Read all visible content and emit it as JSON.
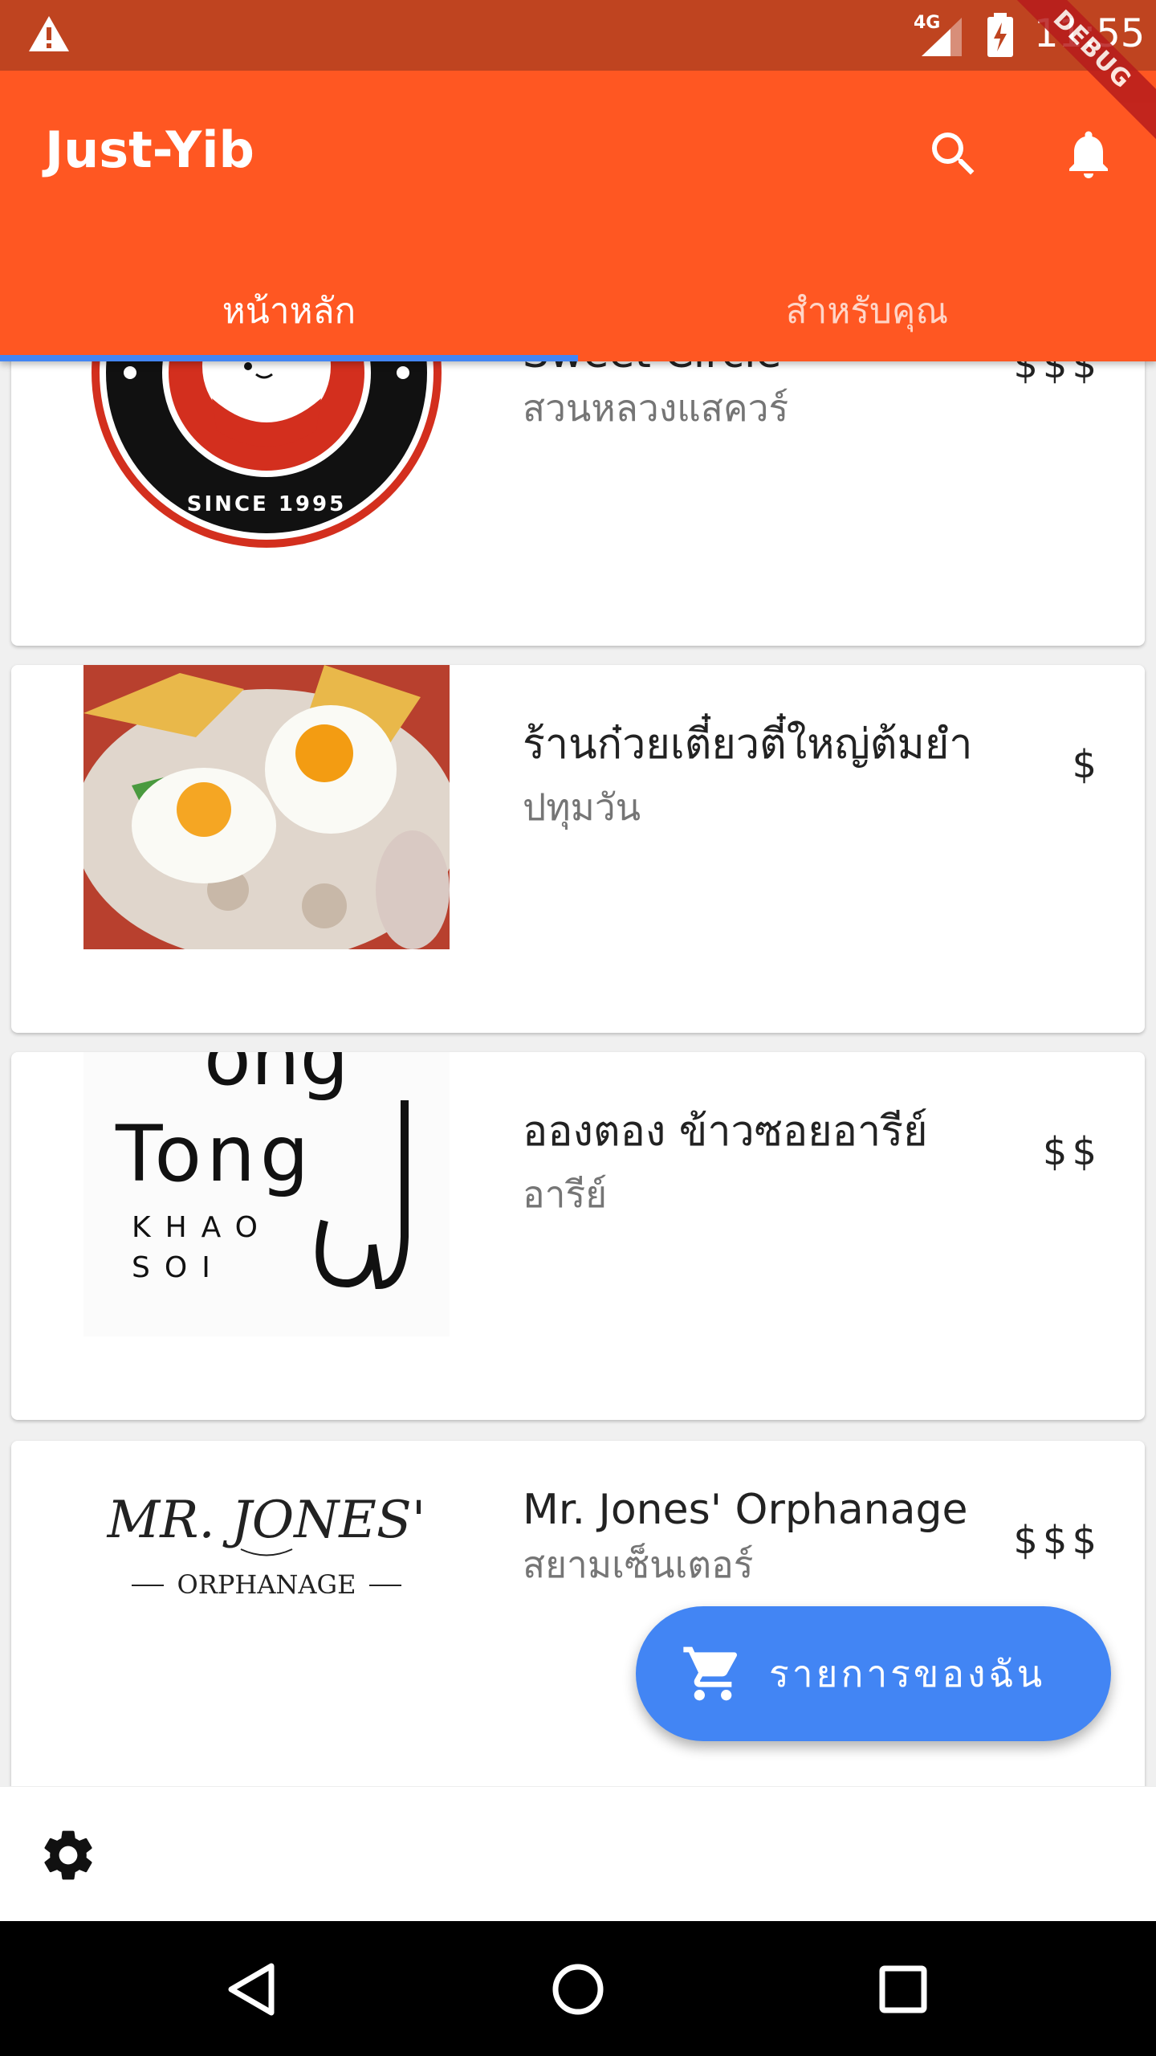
{
  "status_bar": {
    "network": "4G",
    "time": "11:55"
  },
  "debug_banner": "DEBUG",
  "app_bar": {
    "title": "Just-Yib"
  },
  "tabs": [
    {
      "label": "หน้าหลัก",
      "active": true
    },
    {
      "label": "สำหรับคุณ",
      "active": false
    }
  ],
  "restaurants": [
    {
      "name": "Sweet Circle",
      "area": "สวนหลวงแสควร์",
      "price": "$$$",
      "logo_text": "SINCE 1995"
    },
    {
      "name": "ร้านก๋วยเตี๋ยวตี๋ใหญ่ต้มยำ",
      "area": "ปทุมวัน",
      "price": "$"
    },
    {
      "name": "อองตอง ข้าวซอยอารีย์",
      "area": "อารีย์",
      "price": "$$",
      "logo_text_1": "ong",
      "logo_text_2": "Tong",
      "logo_text_3": "KHAO",
      "logo_text_4": "SOI"
    },
    {
      "name": "Mr. Jones' Orphanage",
      "area": "สยามเซ็นเตอร์",
      "price": "$$$",
      "logo_text_1": "MR. JONES'",
      "logo_text_2": "ORPHANAGE"
    }
  ],
  "fab": {
    "label": "รายการของฉัน",
    "icon": "cart-icon"
  },
  "bottom_bar": {
    "icon": "settings-icon"
  },
  "colors": {
    "primary": "#ff5722",
    "status_bar": "#bf4420",
    "accent": "#4285f4"
  }
}
